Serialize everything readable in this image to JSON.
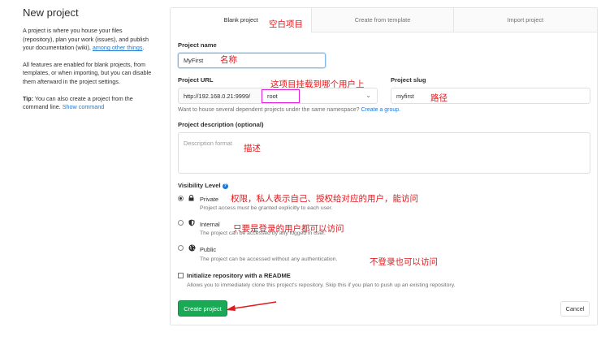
{
  "left": {
    "title": "New project",
    "p1_text": "A project is where you house your files (repository), plan your work (issues), and publish your documentation (wiki),",
    "p1_link": "among other things",
    "p1_end": ".",
    "p2_text": "All features are enabled for blank projects, from templates, or when importing, but you can disable them afterward in the project settings.",
    "tip_label": "Tip:",
    "tip_text": "You can also create a project from the command line.",
    "tip_link": "Show command"
  },
  "tabs": [
    {
      "label": "Blank project",
      "active": true
    },
    {
      "label": "Create from template",
      "active": false
    },
    {
      "label": "Import project",
      "active": false
    }
  ],
  "form": {
    "name_label": "Project name",
    "name_value": "MyFirst",
    "url_label": "Project URL",
    "url_prefix": "http://192.168.0.21:9999/",
    "namespace_value": "root",
    "slug_label": "Project slug",
    "slug_value": "myfirst",
    "namespace_help": "Want to house several dependent projects under the same namespace?",
    "namespace_help_link": "Create a group.",
    "desc_label": "Project description (optional)",
    "desc_placeholder": "Description format",
    "visibility_label": "Visibility Level",
    "visibility": [
      {
        "title": "Private",
        "desc": "Project access must be granted explicitly to each user.",
        "checked": true,
        "icon": "lock-icon"
      },
      {
        "title": "Internal",
        "desc": "The project can be accessed by any logged in user.",
        "checked": false,
        "icon": "shield-icon"
      },
      {
        "title": "Public",
        "desc": "The project can be accessed without any authentication.",
        "checked": false,
        "icon": "globe-icon"
      }
    ],
    "readme_label": "Initialize repository with a README",
    "readme_desc": "Allows you to immediately clone this project's repository. Skip this if you plan to push up an existing repository.",
    "create_button": "Create project",
    "cancel_button": "Cancel"
  },
  "annotations": {
    "blank": "空白项目",
    "name": "名称",
    "user": "这项目挂载到哪个用户上",
    "path": "路径",
    "desc": "描述",
    "private": "权限，私人表示自己、授权给对应的用户，能访问",
    "internal": "只要是登录的用户都可以访问",
    "public": "不登录也可以访问"
  },
  "colors": {
    "accent": "#1aaa55",
    "link": "#1f78d1",
    "annotation": "#e0191e"
  }
}
